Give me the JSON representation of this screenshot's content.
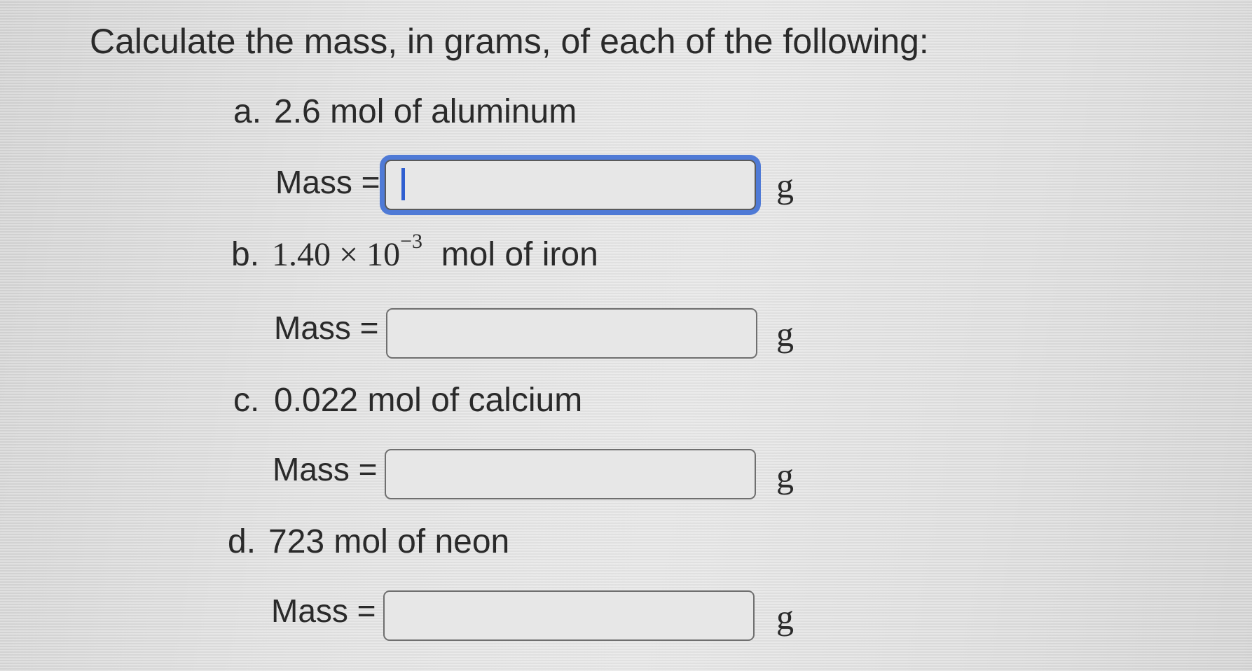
{
  "question": "Calculate the mass, in grams, of each of the following:",
  "items": [
    {
      "letter": "a.",
      "text": "2.6 mol of aluminum",
      "mass_label": "Mass =",
      "unit": "g",
      "value": ""
    },
    {
      "letter": "b.",
      "coefficient": "1.40 × 10",
      "exponent": "−3",
      "text": "mol of iron",
      "mass_label": "Mass =",
      "unit": "g",
      "value": ""
    },
    {
      "letter": "c.",
      "text": "0.022 mol of calcium",
      "mass_label": "Mass =",
      "unit": "g",
      "value": ""
    },
    {
      "letter": "d.",
      "text": "723 mol of neon",
      "mass_label": "Mass =",
      "unit": "g",
      "value": ""
    }
  ],
  "colors": {
    "focus_ring": "#4f7ad6",
    "caret": "#2f5fd0",
    "text": "#2a2a2a"
  }
}
